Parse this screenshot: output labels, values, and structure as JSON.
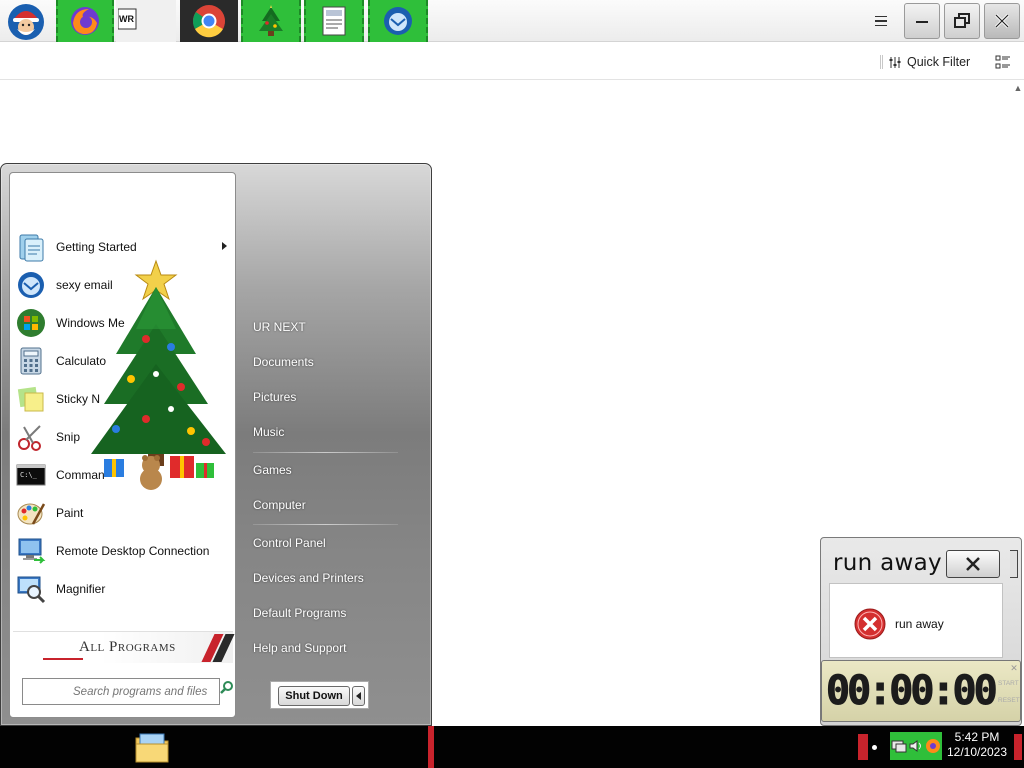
{
  "app_window": {
    "toolbar": {
      "quick_filter_label": "Quick Filter"
    }
  },
  "start_menu": {
    "programs": [
      {
        "label": "Getting Started",
        "icon": "getting-started-icon",
        "has_submenu": true
      },
      {
        "label": "sexy email",
        "icon": "thunderbird-icon",
        "has_submenu": false
      },
      {
        "label": "Windows Me",
        "icon": "windows-media-center-icon",
        "has_submenu": false
      },
      {
        "label": "Calculato",
        "icon": "calculator-icon",
        "has_submenu": false
      },
      {
        "label": "Sticky N",
        "icon": "sticky-notes-icon",
        "has_submenu": false
      },
      {
        "label": "Snip",
        "icon": "snipping-tool-icon",
        "has_submenu": false
      },
      {
        "label": "Comman",
        "icon": "command-prompt-icon",
        "has_submenu": false
      },
      {
        "label": "Paint",
        "icon": "paint-icon",
        "has_submenu": false
      },
      {
        "label": "Remote Desktop Connection",
        "icon": "remote-desktop-icon",
        "has_submenu": false
      },
      {
        "label": "Magnifier",
        "icon": "magnifier-icon",
        "has_submenu": false
      }
    ],
    "all_programs_label": "All Programs",
    "search_placeholder": "Search programs and files",
    "right_items": [
      {
        "label": "UR NEXT"
      },
      {
        "label": "Documents"
      },
      {
        "label": "Pictures"
      },
      {
        "label": "Music"
      },
      {
        "label": "Games"
      },
      {
        "label": "Computer"
      },
      {
        "label": "Control Panel"
      },
      {
        "label": "Devices and Printers"
      },
      {
        "label": "Default Programs"
      },
      {
        "label": "Help and Support"
      }
    ],
    "shutdown_label": "Shut Down"
  },
  "dialog": {
    "title": "run away",
    "message": "run away",
    "icon": "error-icon"
  },
  "timer": {
    "value": "00:00:00",
    "start_label": "START",
    "reset_label": "RESET"
  },
  "taskbar": {
    "apps": [
      {
        "name": "santa-start-orb-icon"
      },
      {
        "name": "firefox-icon"
      },
      {
        "name": "wordpad-icon"
      },
      {
        "name": "file-explorer-icon"
      },
      {
        "name": "chrome-icon"
      },
      {
        "name": "christmas-tree-icon"
      },
      {
        "name": "document-icon"
      },
      {
        "name": "thunderbird-icon"
      }
    ],
    "clock_time": "5:42 PM",
    "clock_date": "12/10/2023"
  },
  "colors": {
    "taskbar_green": "#2fbf3a",
    "accent_red": "#c8232c",
    "taskbar_bg": "#020202"
  }
}
